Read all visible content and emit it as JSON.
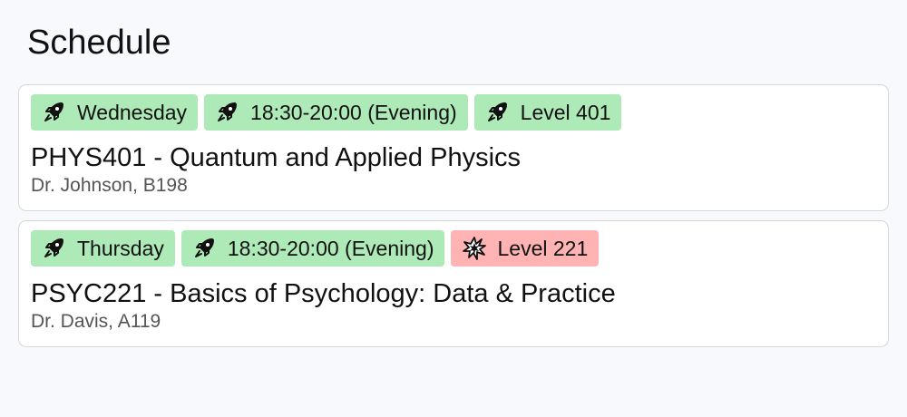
{
  "header": {
    "title": "Schedule"
  },
  "courses": [
    {
      "tags": [
        {
          "label": "Wednesday",
          "icon": "rocket-icon",
          "color": "#aeeab8"
        },
        {
          "label": "18:30-20:00 (Evening)",
          "icon": "rocket-icon",
          "color": "#aeeab8"
        },
        {
          "label": "Level 401",
          "icon": "rocket-icon",
          "color": "#aeeab8"
        }
      ],
      "title": "PHYS401 - Quantum and Applied Physics",
      "meta": "Dr. Johnson, B198"
    },
    {
      "tags": [
        {
          "label": "Thursday",
          "icon": "rocket-icon",
          "color": "#aeeab8"
        },
        {
          "label": "18:30-20:00 (Evening)",
          "icon": "rocket-icon",
          "color": "#aeeab8"
        },
        {
          "label": "Level 221",
          "icon": "explosion-icon",
          "color": "#ffb3b3"
        }
      ],
      "title": "PSYC221 - Basics of Psychology: Data & Practice",
      "meta": "Dr. Davis, A119"
    }
  ]
}
